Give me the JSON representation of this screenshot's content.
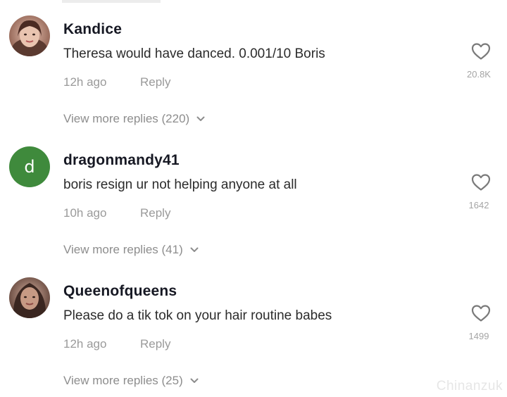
{
  "comments": [
    {
      "username": "Kandice",
      "avatar": {
        "type": "photo",
        "colors": [
          "#c99a86",
          "#6b4338"
        ]
      },
      "text": "Theresa would have danced. 0.001/10 Boris",
      "time": "12h ago",
      "reply_label": "Reply",
      "like_count": "20.8K",
      "view_more": "View more replies (220)"
    },
    {
      "username": "dragonmandy41",
      "avatar": {
        "type": "letter",
        "letter": "d",
        "color": "#3f8a3c"
      },
      "text": "boris resign ur not helping anyone at all",
      "time": "10h ago",
      "reply_label": "Reply",
      "like_count": "1642",
      "view_more": "View more replies (41)"
    },
    {
      "username": "Queenofqueens",
      "avatar": {
        "type": "photo",
        "colors": [
          "#b08a76",
          "#3a2620"
        ]
      },
      "text": "Please do a tik tok on your hair routine babes",
      "time": "12h ago",
      "reply_label": "Reply",
      "like_count": "1499",
      "view_more": "View more replies (25)"
    }
  ],
  "icons": {
    "like": "heart-outline-icon",
    "expand": "chevron-down-icon"
  },
  "watermark": "Chinanzuk"
}
